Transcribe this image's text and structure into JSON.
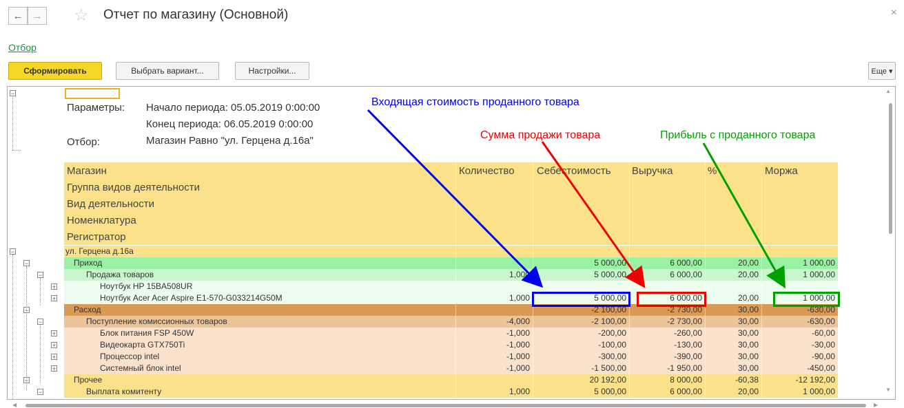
{
  "window": {
    "title": "Отчет по магазину (Основной)",
    "close": "×"
  },
  "nav": {
    "back": "←",
    "forward": "→",
    "star": "☆"
  },
  "filter_link": "Отбор",
  "toolbar": {
    "generate": "Сформировать",
    "choose_variant": "Выбрать вариант...",
    "settings": "Настройки...",
    "more": "Еще ▾"
  },
  "params": {
    "label_params": "Параметры:",
    "period_start": "Начало периода: 05.05.2019 0:00:00",
    "period_end": "Конец периода: 06.05.2019 0:00:00",
    "label_filter": "Отбор:",
    "filter_value": "Магазин Равно \"ул. Герцена д.16а\""
  },
  "annotations": {
    "cost": "Входящая стоимость проданного товара",
    "sales": "Сумма продажи товара",
    "profit": "Прибыль с проданного товара",
    "colors": {
      "cost": "#0000ee",
      "sales": "#ee0000",
      "profit": "#00a000"
    }
  },
  "table": {
    "grouping_headers": [
      "Магазин",
      "Группа видов деятельности",
      "Вид деятельности",
      "Номенклатура",
      "Регистратор"
    ],
    "columns": [
      "Количество",
      "Себестоимость",
      "Выручка",
      "%",
      "Моржа"
    ],
    "rows": [
      {
        "level": 0,
        "name": "ул. Герцена д.16а",
        "qty": "",
        "cost": "",
        "revenue": "",
        "pct": "",
        "margin": "",
        "bg": "#fbe18a"
      },
      {
        "level": 1,
        "name": "Приход",
        "qty": "",
        "cost": "5 000,00",
        "revenue": "6 000,00",
        "pct": "20,00",
        "margin": "1 000,00",
        "bg": "#9af0a3"
      },
      {
        "level": 2,
        "name": "Продажа товаров",
        "qty": "1,000",
        "cost": "5 000,00",
        "revenue": "6 000,00",
        "pct": "20,00",
        "margin": "1 000,00",
        "bg": "#c8f7cc"
      },
      {
        "level": 3,
        "name": "Ноутбук HP 15BA508UR",
        "qty": "",
        "cost": "",
        "revenue": "",
        "pct": "",
        "margin": "",
        "bg": "#ecfded"
      },
      {
        "level": 3,
        "name": "Ноутбук Acer Acer Aspire E1-570-G033214G50M",
        "qty": "1,000",
        "cost": "5 000,00",
        "revenue": "6 000,00",
        "pct": "20,00",
        "margin": "1 000,00",
        "bg": "#ecfded"
      },
      {
        "level": 1,
        "name": "Расход",
        "qty": "",
        "cost": "-2 100,00",
        "revenue": "-2 730,00",
        "pct": "30,00",
        "margin": "-630,00",
        "bg": "#d99a55"
      },
      {
        "level": 2,
        "name": "Поступление комиссионных товаров",
        "qty": "-4,000",
        "cost": "-2 100,00",
        "revenue": "-2 730,00",
        "pct": "30,00",
        "margin": "-630,00",
        "bg": "#ecc49a"
      },
      {
        "level": 3,
        "name": "Блок питания FSP 450W",
        "qty": "-1,000",
        "cost": "-200,00",
        "revenue": "-260,00",
        "pct": "30,00",
        "margin": "-60,00",
        "bg": "#fae2cc"
      },
      {
        "level": 3,
        "name": "Видеокарта GTX750Ti",
        "qty": "-1,000",
        "cost": "-100,00",
        "revenue": "-130,00",
        "pct": "30,00",
        "margin": "-30,00",
        "bg": "#fae2cc"
      },
      {
        "level": 3,
        "name": "Процессор intel",
        "qty": "-1,000",
        "cost": "-300,00",
        "revenue": "-390,00",
        "pct": "30,00",
        "margin": "-90,00",
        "bg": "#fae2cc"
      },
      {
        "level": 3,
        "name": "Системный блок intel",
        "qty": "-1,000",
        "cost": "-1 500,00",
        "revenue": "-1 950,00",
        "pct": "30,00",
        "margin": "-450,00",
        "bg": "#fae2cc"
      },
      {
        "level": 1,
        "name": "Прочее",
        "qty": "",
        "cost": "20 192,00",
        "revenue": "8 000,00",
        "pct": "-60,38",
        "margin": "-12 192,00",
        "bg": "#fbe18a"
      },
      {
        "level": 2,
        "name": "Выплата комитенту",
        "qty": "1,000",
        "cost": "5 000,00",
        "revenue": "6 000,00",
        "pct": "20,00",
        "margin": "1 000,00",
        "bg": "#fbe18a"
      }
    ]
  },
  "colors": {
    "header": "#fbe18a",
    "accent_button": "#f5d72a",
    "link": "#12963c"
  }
}
